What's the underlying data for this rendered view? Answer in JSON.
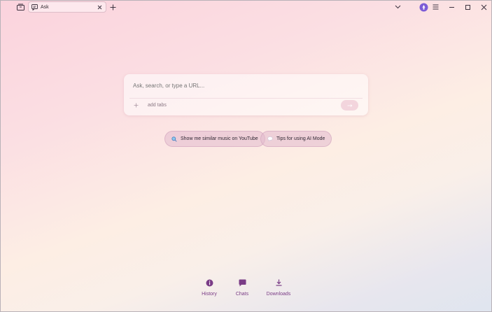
{
  "tab": {
    "title": "Ask"
  },
  "search": {
    "placeholder": "Ask, search, or type a URL...",
    "add_tabs_label": "add tabs"
  },
  "suggestions": [
    {
      "label": "Show me similar music on YouTube",
      "icon": "search-icon"
    },
    {
      "label": "Tips for using AI Mode",
      "icon": "chat-bubble-icon"
    }
  ],
  "shortcuts": [
    {
      "label": "History",
      "icon": "info-icon"
    },
    {
      "label": "Chats",
      "icon": "chat-icon"
    },
    {
      "label": "Downloads",
      "icon": "download-icon"
    }
  ],
  "colors": {
    "accent": "#7a3c86",
    "profile": "#7c5cd6"
  }
}
